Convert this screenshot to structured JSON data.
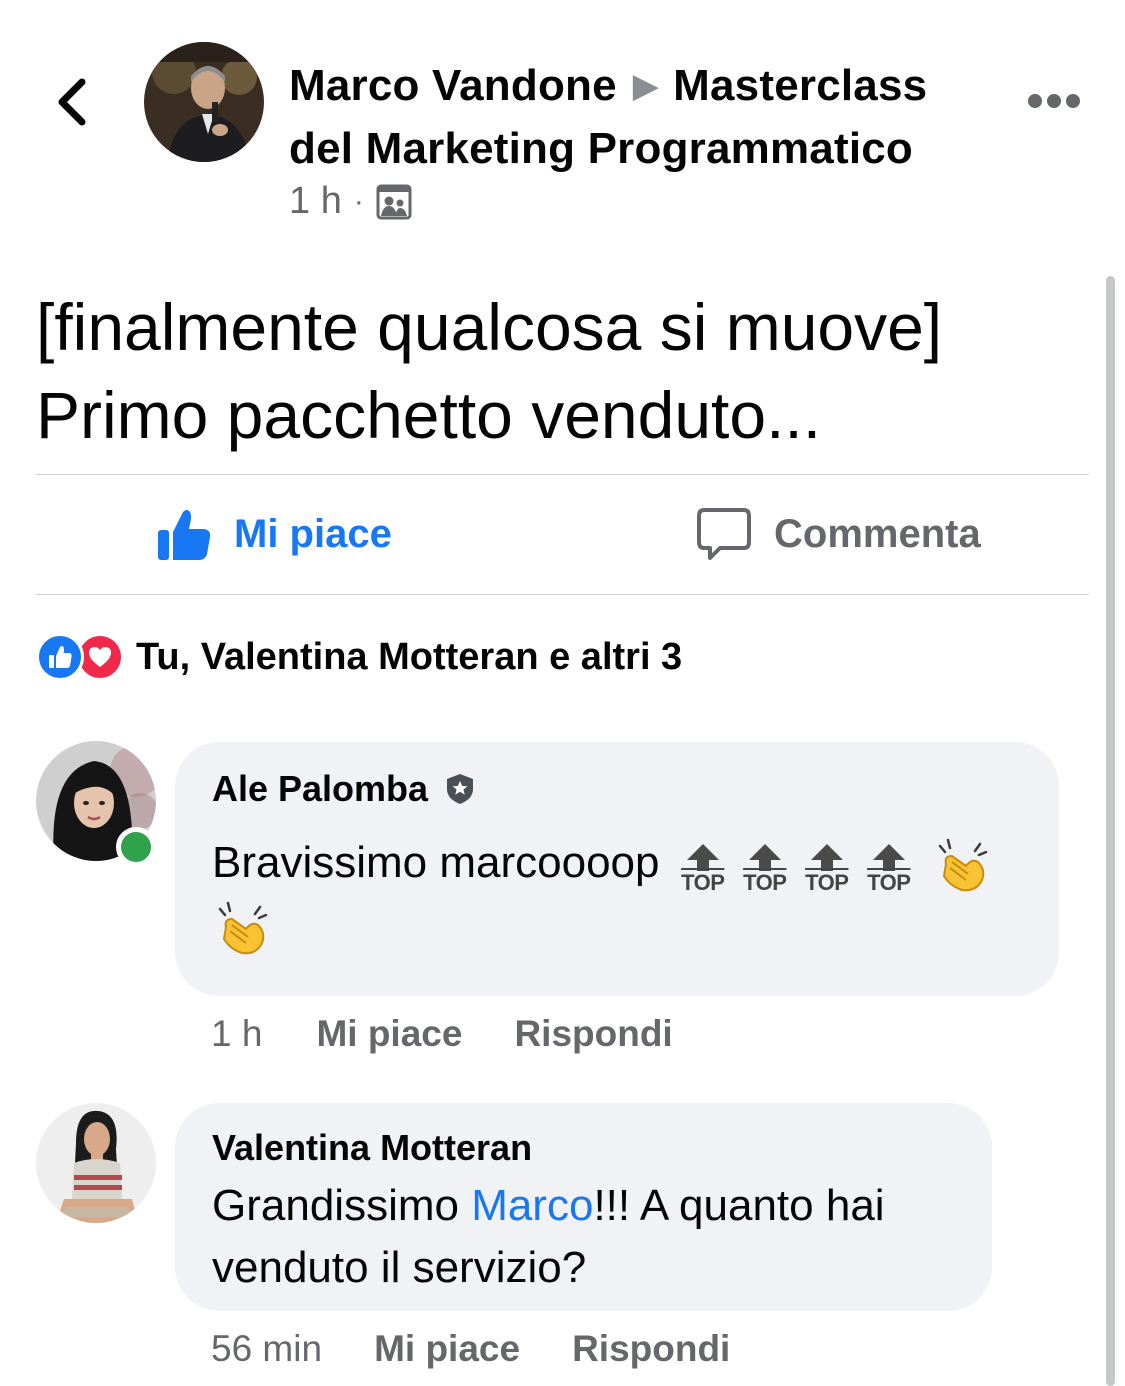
{
  "header": {
    "author": "Marco Vandone",
    "group": "Masterclass del Marketing Programmatico",
    "time": "1 h",
    "privacy_icon": "group-icon"
  },
  "post": {
    "line1": "[finalmente qualcosa si muove]",
    "line2": "Primo pacchetto venduto..."
  },
  "actions": {
    "like": "Mi piace",
    "comment": "Commenta"
  },
  "reactions": {
    "summary": "Tu, Valentina Motteran e altri 3",
    "icons": [
      "like-reaction-icon",
      "love-reaction-icon"
    ]
  },
  "comments": [
    {
      "name": "Ale Palomba",
      "text": "Bravissimo marcoooop",
      "emoji_label": "TOP",
      "time": "1 h",
      "like": "Mi piace",
      "reply": "Rispondi"
    },
    {
      "name": "Valentina Motteran",
      "text_before": "Grandissimo ",
      "mention": "Marco",
      "text_after": "!!! A quanto hai venduto il servizio?",
      "time": "56 min",
      "like": "Mi piace",
      "reply": "Rispondi"
    }
  ],
  "colors": {
    "accent": "#1877f2",
    "secondary_text": "#65676b",
    "bubble": "#f0f2f5",
    "love": "#f02849",
    "online": "#31a24c"
  }
}
